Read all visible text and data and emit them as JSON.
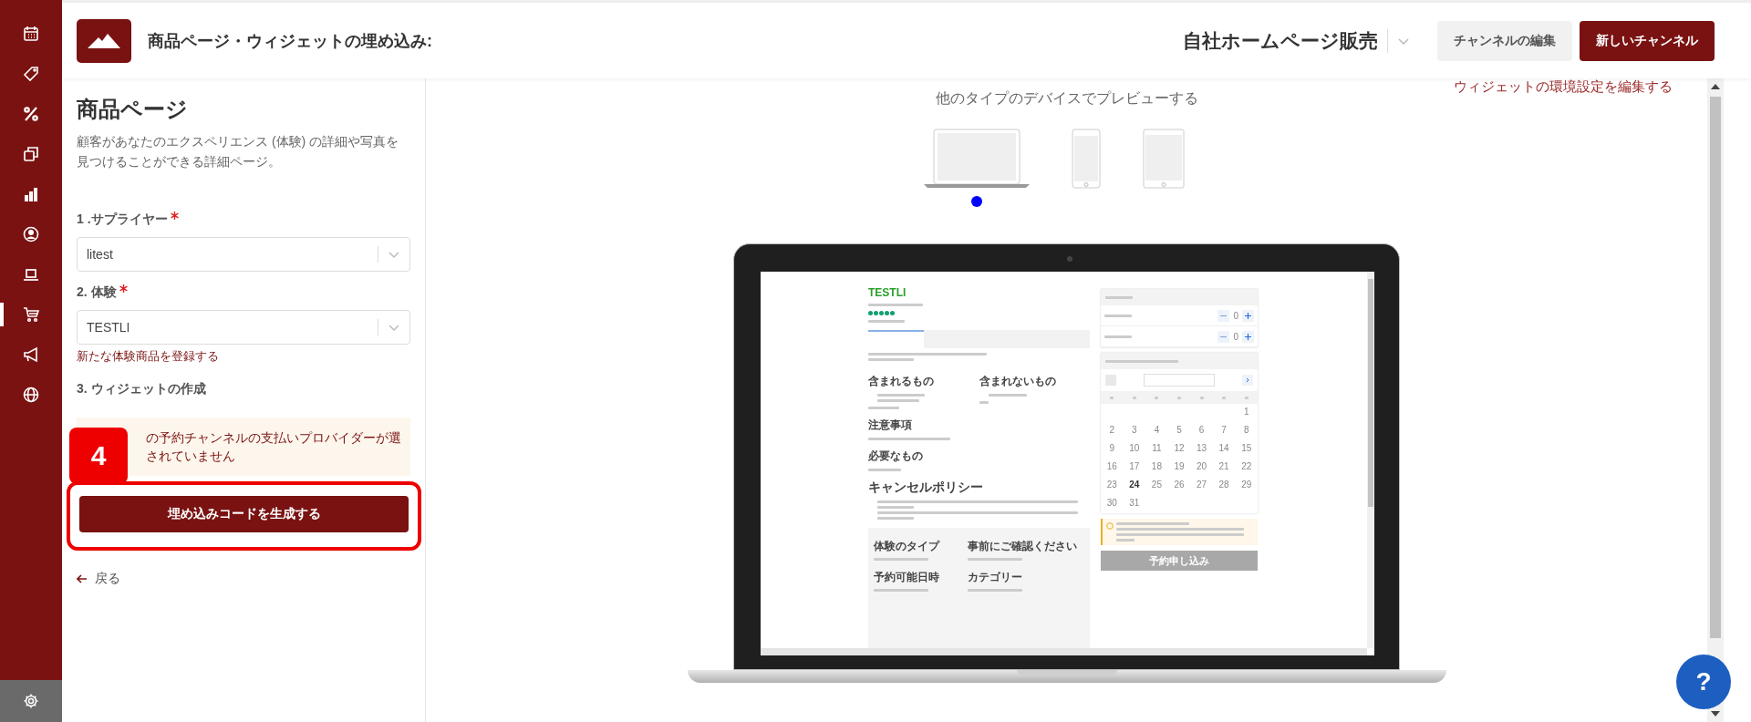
{
  "sidebar": {
    "items": [
      {
        "kind": "calendar",
        "selected": false
      },
      {
        "kind": "tag",
        "selected": false
      },
      {
        "kind": "percent",
        "selected": false
      },
      {
        "kind": "copy",
        "selected": false
      },
      {
        "kind": "chart",
        "selected": false
      },
      {
        "kind": "user",
        "selected": false
      },
      {
        "kind": "laptop",
        "selected": false
      },
      {
        "kind": "cart",
        "selected": true
      },
      {
        "kind": "megaphone",
        "selected": false
      },
      {
        "kind": "globe",
        "selected": false
      }
    ]
  },
  "header": {
    "title": "商品ページ・ウィジェットの埋め込み:",
    "channel": "自社ホームページ販売",
    "buttons": [
      {
        "label": "チャンネルの編集",
        "kind": "secondary"
      },
      {
        "label": "新しいチャンネル",
        "kind": "primary"
      }
    ]
  },
  "form": {
    "title": "商品ページ",
    "description": "顧客があなたのエクスペリエンス (体験) の詳細や写真を見つけることができる詳細ページ。",
    "fields": [
      {
        "label": "1 .サプライヤー",
        "required": true,
        "value": "litest"
      },
      {
        "label": "2. 体験",
        "required": true,
        "value": "TESTLI"
      }
    ],
    "register_link": "新たな体験商品を登録する",
    "step3": "3. ウィジェットの作成",
    "warning_lines": [
      "の予約チャンネルの支払いプロバイダーが選",
      "されていません"
    ],
    "step_badge": "4",
    "generate_button": "埋め込みコードを生成する",
    "back_link": "戻る"
  },
  "main": {
    "settings_link": "ウィジェットの環境設定を編集する",
    "preview_title": "他のタイプのデバイスでプレビューする",
    "devices": [
      {
        "kind": "laptop",
        "selected": true
      },
      {
        "kind": "phone",
        "selected": false
      },
      {
        "kind": "tablet",
        "selected": false
      }
    ],
    "preview": {
      "product_title": "TESTLI",
      "stars": 5,
      "tabs": [
        {
          "selected": true
        },
        {
          "selected": false
        },
        {
          "selected": false
        },
        {
          "selected": false
        }
      ],
      "included_heading": "含まれるもの",
      "excluded_heading": "含まれないもの",
      "notes_heading": "注意事項",
      "bring_heading": "必要なもの",
      "cancel_heading": "キャンセルポリシー",
      "info": [
        "体験のタイプ",
        "事前にご確認ください",
        "予約可能日時",
        "カテゴリー"
      ],
      "counters": [
        {
          "value": "0"
        },
        {
          "value": "0"
        }
      ],
      "days": [
        {
          "d": "1",
          "today": false
        },
        {
          "d": "2",
          "today": false
        },
        {
          "d": "3",
          "today": false
        },
        {
          "d": "4",
          "today": false
        },
        {
          "d": "5",
          "today": false
        },
        {
          "d": "6",
          "today": false
        },
        {
          "d": "7",
          "today": false
        },
        {
          "d": "8",
          "today": false
        },
        {
          "d": "9",
          "today": false
        },
        {
          "d": "10",
          "today": false
        },
        {
          "d": "11",
          "today": false
        },
        {
          "d": "12",
          "today": false
        },
        {
          "d": "13",
          "today": false
        },
        {
          "d": "14",
          "today": false
        },
        {
          "d": "15",
          "today": false
        },
        {
          "d": "16",
          "today": false
        },
        {
          "d": "17",
          "today": false
        },
        {
          "d": "18",
          "today": false
        },
        {
          "d": "19",
          "today": false
        },
        {
          "d": "20",
          "today": false
        },
        {
          "d": "21",
          "today": false
        },
        {
          "d": "22",
          "today": false
        },
        {
          "d": "23",
          "today": false
        },
        {
          "d": "24",
          "today": true
        },
        {
          "d": "25",
          "today": false
        },
        {
          "d": "26",
          "today": false
        },
        {
          "d": "27",
          "today": false
        },
        {
          "d": "28",
          "today": false
        },
        {
          "d": "29",
          "today": false
        },
        {
          "d": "30",
          "today": false
        },
        {
          "d": "31",
          "today": false
        }
      ],
      "book_button": "予約申し込み"
    }
  },
  "help_button": "?"
}
